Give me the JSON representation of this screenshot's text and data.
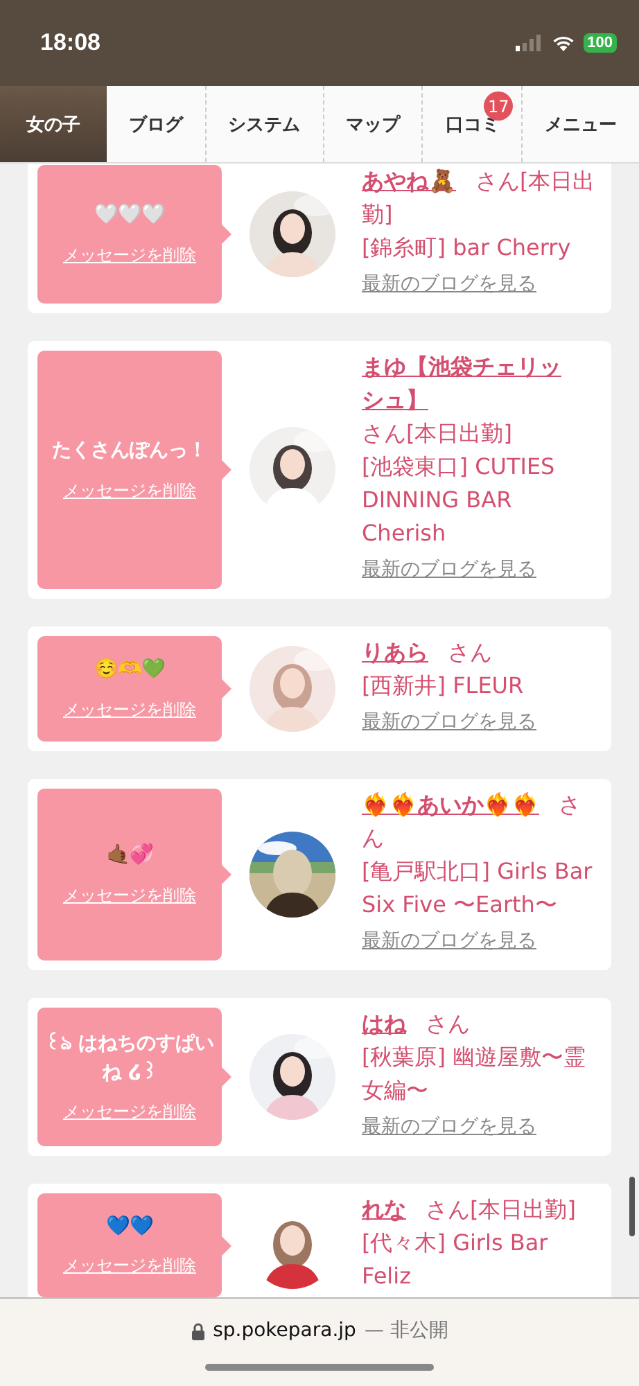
{
  "status_bar": {
    "time": "18:08",
    "battery": "100"
  },
  "tabs": [
    {
      "label": "女の子",
      "selected": true
    },
    {
      "label": "ブログ",
      "selected": false
    },
    {
      "label": "システム",
      "selected": false
    },
    {
      "label": "マップ",
      "selected": false
    },
    {
      "label": "口コミ",
      "selected": false,
      "badge": "17"
    },
    {
      "label": "メニュー",
      "selected": false
    }
  ],
  "cards": [
    {
      "message": "🤍🤍🤍",
      "delete_link": "メッセージを削除",
      "name": "あやね🧸",
      "suffix": "さん[本日出勤]",
      "shop": "[錦糸町] bar Cherry",
      "blog_link": "最新のブログを見る"
    },
    {
      "message": "たくさんぽんっ！",
      "delete_link": "メッセージを削除",
      "name": "まゆ【池袋チェリッシュ】",
      "suffix": "さん[本日出勤]",
      "shop": "[池袋東口] CUTIES DINNING BAR Cherish",
      "blog_link": "最新のブログを見る"
    },
    {
      "message": "☺️🫶💚",
      "delete_link": "メッセージを削除",
      "name": "りあら",
      "suffix": "さん",
      "shop": "[西新井] FLEUR",
      "blog_link": "最新のブログを見る"
    },
    {
      "message": "🤙🏾💞",
      "delete_link": "メッセージを削除",
      "name": "❤️‍🔥❤️‍🔥あいか❤️‍🔥❤️‍🔥",
      "suffix": "さん",
      "shop": "[亀戸駅北口] Girls Bar Six Five 〜Earth〜",
      "blog_link": "最新のブログを見る"
    },
    {
      "message": "꒰ঌ はねちのすぱいね ໒꒱",
      "delete_link": "メッセージを削除",
      "name": "はね",
      "suffix": "さん",
      "shop": "[秋葉原] 幽遊屋敷〜霊女編〜",
      "blog_link": "最新のブログを見る"
    },
    {
      "message": "💙💙",
      "delete_link": "メッセージを削除",
      "name": "れな",
      "suffix": "さん[本日出勤]",
      "shop": "[代々木] Girls Bar Feliz"
    }
  ],
  "address_bar": {
    "domain": "sp.pokepara.jp",
    "note": "— 非公開"
  }
}
